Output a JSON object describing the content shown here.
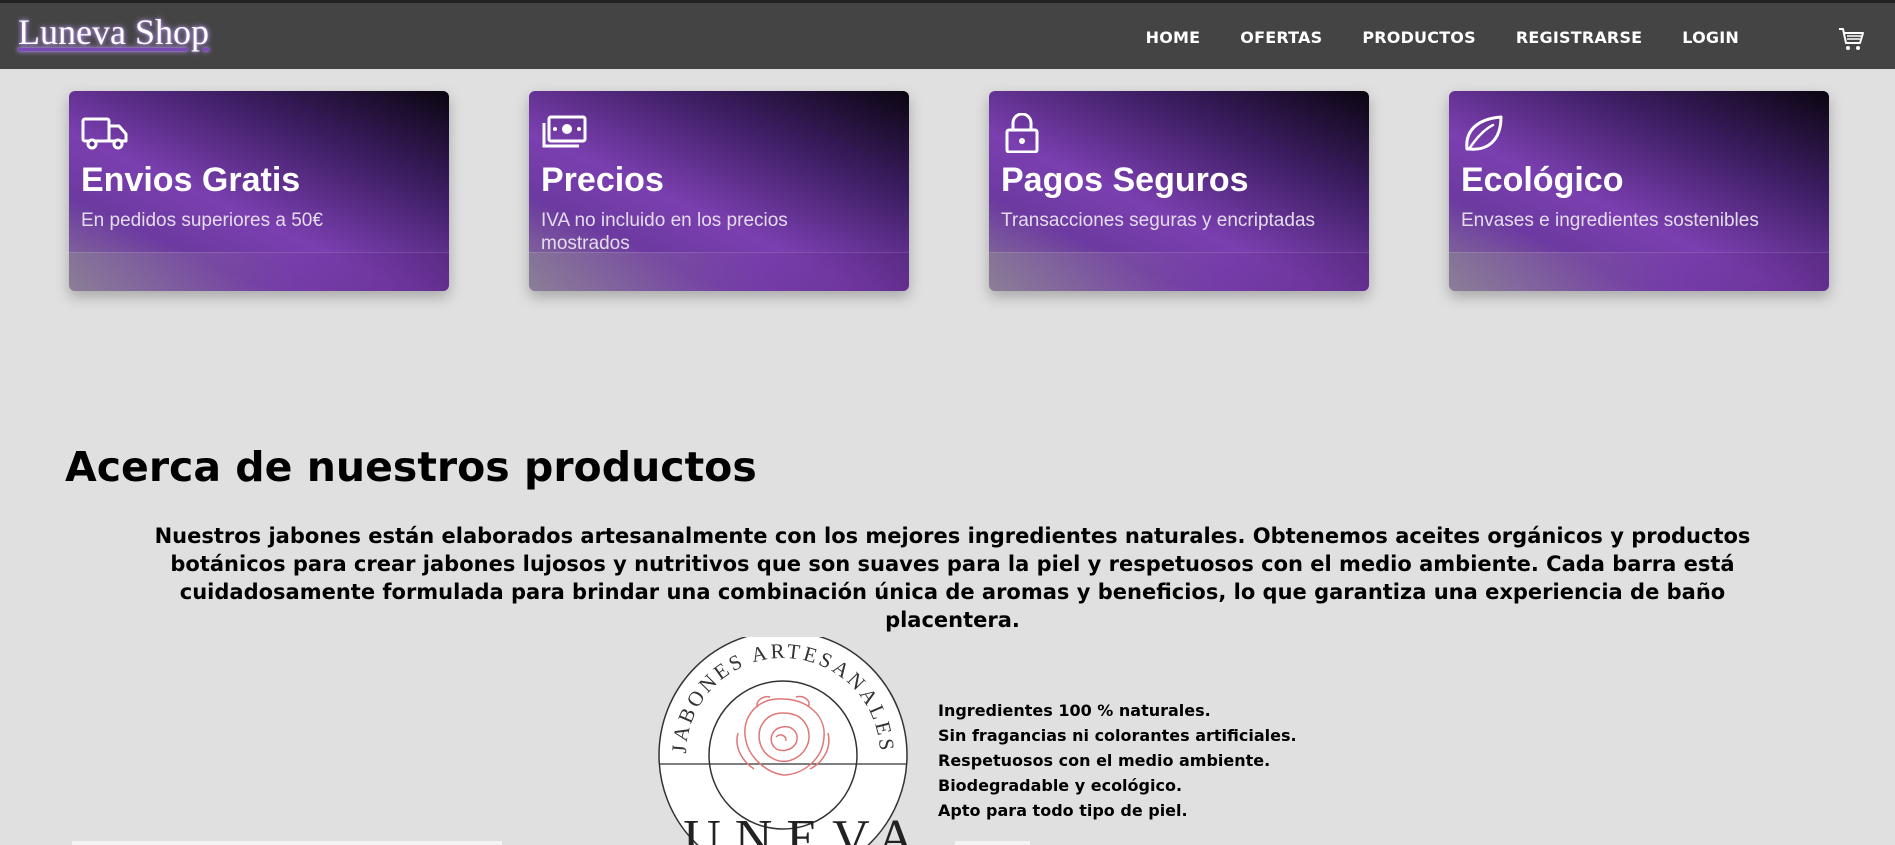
{
  "brand": "Luneva Shop",
  "nav": {
    "home": "HOME",
    "ofertas": "OFERTAS",
    "productos": "PRODUCTOS",
    "registrarse": "REGISTRARSE",
    "login": "LOGIN"
  },
  "cart_icon": "shopping-cart-icon",
  "features": [
    {
      "icon": "truck-icon",
      "title": "Envios Gratis",
      "text": "En pedidos superiores a 50€"
    },
    {
      "icon": "money-icon",
      "title": "Precios",
      "text": "IVA no incluido en los precios mostrados"
    },
    {
      "icon": "lock-icon",
      "title": "Pagos Seguros",
      "text": "Transacciones seguras y encriptadas"
    },
    {
      "icon": "leaf-icon",
      "title": "Ecológico",
      "text": "Envases e ingredientes sostenibles"
    }
  ],
  "about": {
    "title": "Acerca de nuestros productos",
    "text": "Nuestros jabones están elaborados artesanalmente con los mejores ingredientes naturales. Obtenemos aceites orgánicos y productos botánicos para crear jabones lujosos y nutritivos que son suaves para la piel y respetuosos con el medio ambiente. Cada barra está cuidadosamente formulada para brindar una combinación única de aromas y beneficios, lo que garantiza una experiencia de baño placentera.",
    "logo_text": "JABONES ARTESANALES",
    "logo_bottom": "LUNEVA",
    "points": [
      "Ingredientes 100 % naturales.",
      "Sin fragancias ni colorantes artificiales.",
      "Respetuosos con el medio ambiente.",
      "Biodegradable y ecológico.",
      "Apto para todo tipo de piel."
    ]
  },
  "colors": {
    "navbar": "#444444",
    "background": "#e0e0e0",
    "accent": "#7b3fb0"
  }
}
